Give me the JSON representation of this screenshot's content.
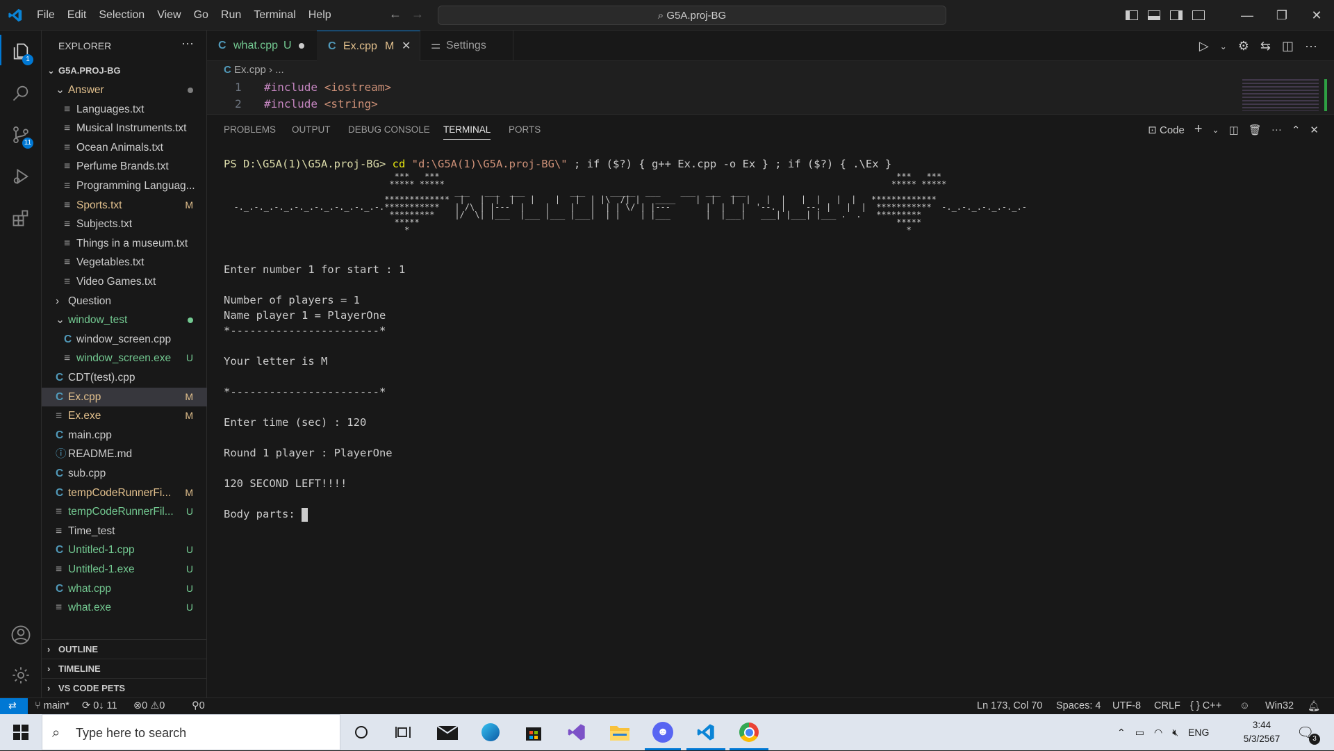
{
  "titlebar": {
    "menu": [
      "File",
      "Edit",
      "Selection",
      "View",
      "Go",
      "Run",
      "Terminal",
      "Help"
    ],
    "search_text": "G5A.proj-BG"
  },
  "activity": {
    "explorer_badge": "1",
    "scm_badge": "11"
  },
  "sidebar": {
    "header": "EXPLORER",
    "root": "G5A.PROJ-BG",
    "rows": [
      {
        "label": "Answer",
        "status": "",
        "kind": "folder-open",
        "color": "mod",
        "dot": true
      },
      {
        "label": "Languages.txt",
        "status": "",
        "kind": "txt",
        "color": "def"
      },
      {
        "label": "Musical Instruments.txt",
        "status": "",
        "kind": "txt",
        "color": "def"
      },
      {
        "label": "Ocean Animals.txt",
        "status": "",
        "kind": "txt",
        "color": "def"
      },
      {
        "label": "Perfume Brands.txt",
        "status": "",
        "kind": "txt",
        "color": "def"
      },
      {
        "label": "Programming Languag...",
        "status": "",
        "kind": "txt",
        "color": "def"
      },
      {
        "label": "Sports.txt",
        "status": "M",
        "kind": "txt",
        "color": "mod"
      },
      {
        "label": "Subjects.txt",
        "status": "",
        "kind": "txt",
        "color": "def"
      },
      {
        "label": "Things in a museum.txt",
        "status": "",
        "kind": "txt",
        "color": "def"
      },
      {
        "label": "Vegetables.txt",
        "status": "",
        "kind": "txt",
        "color": "def"
      },
      {
        "label": "Video Games.txt",
        "status": "",
        "kind": "txt",
        "color": "def"
      },
      {
        "label": "Question",
        "status": "",
        "kind": "folder-closed",
        "color": "def"
      },
      {
        "label": "window_test",
        "status": "",
        "kind": "folder-open",
        "color": "new",
        "dot": true
      },
      {
        "label": "window_screen.cpp",
        "status": "",
        "kind": "cpp",
        "color": "def"
      },
      {
        "label": "window_screen.exe",
        "status": "U",
        "kind": "exe",
        "color": "new"
      },
      {
        "label": "CDT(test).cpp",
        "status": "",
        "kind": "cpp",
        "color": "def"
      },
      {
        "label": "Ex.cpp",
        "status": "M",
        "kind": "cpp",
        "color": "mod",
        "selected": true
      },
      {
        "label": "Ex.exe",
        "status": "M",
        "kind": "exe",
        "color": "mod"
      },
      {
        "label": "main.cpp",
        "status": "",
        "kind": "cpp",
        "color": "def"
      },
      {
        "label": "README.md",
        "status": "",
        "kind": "info",
        "color": "def"
      },
      {
        "label": "sub.cpp",
        "status": "",
        "kind": "cpp",
        "color": "def"
      },
      {
        "label": "tempCodeRunnerFi...",
        "status": "M",
        "kind": "cpp",
        "color": "mod"
      },
      {
        "label": "tempCodeRunnerFil...",
        "status": "U",
        "kind": "txt",
        "color": "new"
      },
      {
        "label": "Time_test",
        "status": "",
        "kind": "txt",
        "color": "def"
      },
      {
        "label": "Untitled-1.cpp",
        "status": "U",
        "kind": "cpp",
        "color": "new"
      },
      {
        "label": "Untitled-1.exe",
        "status": "U",
        "kind": "exe",
        "color": "new"
      },
      {
        "label": "what.cpp",
        "status": "U",
        "kind": "cpp",
        "color": "new"
      },
      {
        "label": "what.exe",
        "status": "U",
        "kind": "exe",
        "color": "new"
      }
    ],
    "sections": [
      "OUTLINE",
      "TIMELINE",
      "VS CODE PETS"
    ]
  },
  "tabs": [
    {
      "label": "what.cpp",
      "status": "U",
      "active": false
    },
    {
      "label": "Ex.cpp",
      "status": "M",
      "active": true
    },
    {
      "label": "Settings",
      "status": "",
      "active": false
    }
  ],
  "editor": {
    "breadcrumb_file": "Ex.cpp",
    "breadcrumb_more": "...",
    "lines": [
      {
        "num": "1",
        "kw": "#include",
        "rest": "<iostream>"
      },
      {
        "num": "2",
        "kw": "#include",
        "rest": "<string>"
      }
    ]
  },
  "panel": {
    "tabs": [
      "PROBLEMS",
      "OUTPUT",
      "DEBUG CONSOLE",
      "TERMINAL",
      "PORTS"
    ],
    "active_tab": "TERMINAL",
    "terminal_name": "Code",
    "prompt": "PS D:\\G5A(1)\\G5A.proj-BG>",
    "command": "cd",
    "command_path": "\"d:\\G5A(1)\\G5A.proj-BG\\\"",
    "command_rest": " ; if ($?) { g++ Ex.cpp -o Ex } ; if ($?) { .\\Ex }",
    "banner": [
      "                                  ***   ***                                                                                           ***   ***",
      "                                 ***** *****                                                                                         ***** *****",
      "                                              ___   ___  ___         ___     _____  ___    ___  ___  ___",
      "                                *************  |   |  |  |   |    |   |  | |\\  /| |   ____    |  |   |  |   |  |   |  |   |  |   *************",
      "  -._.-._.-._.-._.-._.-._.-._.-.***********   | /\\ | |---  |    |    |   |  | | \\/ | |---       |  |   |  '--. |    --. |   |  |  ***********  -._.-._.-._.-._.-",
      "                                 *********    |/  \\| |___  |___ |___ |___|  | |    | |___       |  |___|   ___| |___| |___ .  .   *********",
      "                                  *****                                                                                               *****",
      "                                    *                                                                                                   *"
    ],
    "lines": [
      "Enter number 1 for start : 1",
      "",
      "Number of players = 1",
      "Name player 1 = PlayerOne",
      "*-----------------------*",
      "",
      "Your letter is M",
      "",
      "*-----------------------*",
      "",
      "Enter time (sec) : 120",
      "",
      "Round 1 player : PlayerOne",
      "",
      "120 SECOND LEFT!!!!",
      "",
      "Body parts: "
    ]
  },
  "status": {
    "branch": "main*",
    "sync": "0↓ 11",
    "errors": "0",
    "warnings": "0",
    "ports": "0",
    "position": "Ln 173, Col 70",
    "spaces": "Spaces: 4",
    "encoding": "UTF-8",
    "eol": "CRLF",
    "language": "C++",
    "platform": "Win32"
  },
  "taskbar": {
    "search_placeholder": "Type here to search",
    "language": "ENG",
    "time": "3:44",
    "date": "5/3/2567",
    "notif_count": "3"
  },
  "colors": {
    "accent": "#0078d4",
    "modified": "#e2c08d",
    "untracked": "#73c991"
  }
}
